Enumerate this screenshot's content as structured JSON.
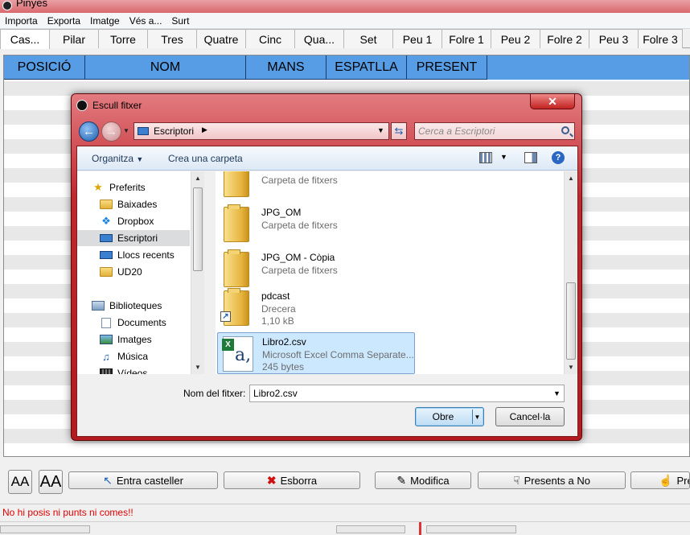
{
  "window": {
    "title": "Pinyes"
  },
  "menu": [
    "Importa",
    "Exporta",
    "Imatge",
    "Vés a...",
    "Surt"
  ],
  "tabs": [
    {
      "label": "Cas...",
      "active": true
    },
    {
      "label": "Pilar"
    },
    {
      "label": "Torre"
    },
    {
      "label": "Tres"
    },
    {
      "label": "Quatre"
    },
    {
      "label": "Cinc"
    },
    {
      "label": "Qua..."
    },
    {
      "label": "Set"
    },
    {
      "label": "Peu 1"
    },
    {
      "label": "Folre 1"
    },
    {
      "label": "Peu 2"
    },
    {
      "label": "Folre 2"
    },
    {
      "label": "Peu 3"
    },
    {
      "label": "Folre 3"
    }
  ],
  "table": {
    "columns": [
      "POSICIÓ",
      "NOM",
      "MANS",
      "ESPATLLA",
      "PRESENT"
    ],
    "header_color": "#569de5"
  },
  "toolbar": {
    "font_smaller": "AA",
    "font_larger": "AA",
    "add_label": "Entra casteller",
    "delete_label": "Esborra",
    "edit_label": "Modifica",
    "present_label": "Presents a No",
    "extra_label": "Pre"
  },
  "status": {
    "message": "No hi posis ni punts ni comes!!"
  },
  "dialog": {
    "title": "Escull fitxer",
    "address": "Escriptori",
    "search_placeholder": "Cerca a Escriptori",
    "organize_label": "Organitza",
    "new_folder_label": "Crea una carpeta",
    "nav_items": [
      {
        "label": "Preferits",
        "icon": "star-icon",
        "indent": false
      },
      {
        "label": "Baixades",
        "icon": "download-folder-icon",
        "indent": true
      },
      {
        "label": "Dropbox",
        "icon": "dropbox-icon",
        "indent": true
      },
      {
        "label": "Escriptori",
        "icon": "desktop-icon",
        "indent": true,
        "selected": true
      },
      {
        "label": "Llocs recents",
        "icon": "recent-places-icon",
        "indent": true
      },
      {
        "label": "UD20",
        "icon": "folder-icon",
        "indent": true
      },
      {
        "label": "Biblioteques",
        "icon": "library-icon",
        "indent": false
      },
      {
        "label": "Documents",
        "icon": "documents-icon",
        "indent": true
      },
      {
        "label": "Imatges",
        "icon": "pictures-icon",
        "indent": true
      },
      {
        "label": "Música",
        "icon": "music-icon",
        "indent": true
      },
      {
        "label": "Vídeos",
        "icon": "videos-icon",
        "indent": true
      }
    ],
    "files": [
      {
        "name": "",
        "type": "Carpeta de fitxers",
        "size": "",
        "kind": "folder"
      },
      {
        "name": "JPG_OM",
        "type": "Carpeta de fitxers",
        "size": "",
        "kind": "folder"
      },
      {
        "name": "JPG_OM - Còpia",
        "type": "Carpeta de fitxers",
        "size": "",
        "kind": "folder"
      },
      {
        "name": "pdcast",
        "type": "Drecera",
        "size": "1,10 kB",
        "kind": "shortcut"
      },
      {
        "name": "Libro2.csv",
        "type": "Microsoft Excel Comma Separate...",
        "size": "245 bytes",
        "kind": "csv",
        "selected": true
      }
    ],
    "filename_label": "Nom del fitxer:",
    "filename_value": "Libro2.csv",
    "open_label": "Obre",
    "cancel_label": "Cancel·la"
  }
}
